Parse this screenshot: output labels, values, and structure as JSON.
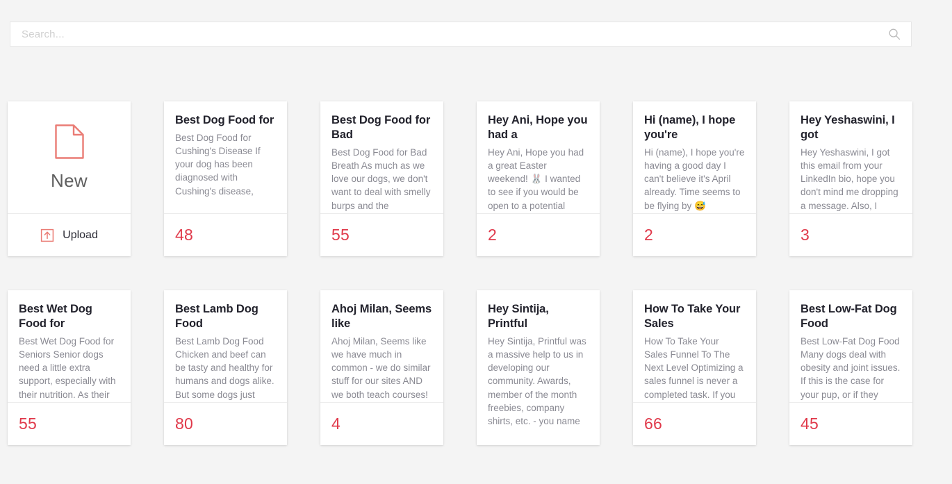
{
  "search": {
    "placeholder": "Search...",
    "value": "",
    "icon": "search-icon"
  },
  "new_card": {
    "doc_icon": "document-page-icon",
    "label": "New",
    "upload_icon": "upload-icon",
    "upload_label": "Upload"
  },
  "colors": {
    "background": "#f4f4f4",
    "card": "#ffffff",
    "accent_red": "#e0394a",
    "accent_salmon": "#ea7c75",
    "title": "#22222c",
    "excerpt": "#8a8a93",
    "divider": "#ececec"
  },
  "cards": [
    {
      "title": "Best Dog Food for",
      "excerpt": "Best Dog Food for Cushing's Disease If your dog has been diagnosed with Cushing's disease,",
      "count": "48",
      "has_footer": true
    },
    {
      "title": "Best Dog Food for Bad",
      "excerpt": "Best Dog Food for Bad Breath As much as we love our dogs, we don't want to deal with smelly burps and the",
      "count": "55",
      "has_footer": true
    },
    {
      "title": "Hey Ani, Hope you had a",
      "excerpt": "Hey Ani, Hope you had a great Easter weekend! 🐰 I wanted to see if you would be open to a potential",
      "count": "2",
      "has_footer": true
    },
    {
      "title": "Hi (name), I hope you're",
      "excerpt": "Hi (name), I hope you're having a good day I can't believe it's April already. Time seems to be flying by 😅",
      "count": "2",
      "has_footer": true
    },
    {
      "title": "Hey Yeshaswini, I got",
      "excerpt": "Hey Yeshaswini, I got this email from your LinkedIn bio, hope you don't mind me dropping a message. Also, I",
      "count": "3",
      "has_footer": true
    },
    {
      "title": "Best Wet Dog Food for",
      "excerpt": "Best Wet Dog Food for Seniors Senior dogs need a little extra support, especially with their nutrition. As their",
      "count": "55",
      "has_footer": true
    },
    {
      "title": "Best Lamb Dog Food",
      "excerpt": "Best Lamb Dog Food Chicken and beef can be tasty and healthy for humans and dogs alike. But some dogs just",
      "count": "80",
      "has_footer": true
    },
    {
      "title": "Ahoj Milan, Seems like",
      "excerpt": "Ahoj Milan, Seems like we have much in common - we do similar stuff for our sites AND we both teach courses!",
      "count": "4",
      "has_footer": true
    },
    {
      "title": "Hey Sintija, Printful",
      "excerpt": "Hey Sintija, Printful was a massive help to us in developing our community. Awards, member of the month freebies, company shirts, etc. - you name",
      "count": "",
      "has_footer": false
    },
    {
      "title": "How To Take Your Sales",
      "excerpt": "How To Take Your Sales Funnel To The Next Level Optimizing a sales funnel is never a completed task. If you",
      "count": "66",
      "has_footer": true
    },
    {
      "title": "Best Low-Fat Dog Food",
      "excerpt": "Best Low-Fat Dog Food Many dogs deal with obesity and joint issues. If this is the case for your pup, or if they",
      "count": "45",
      "has_footer": true
    }
  ]
}
